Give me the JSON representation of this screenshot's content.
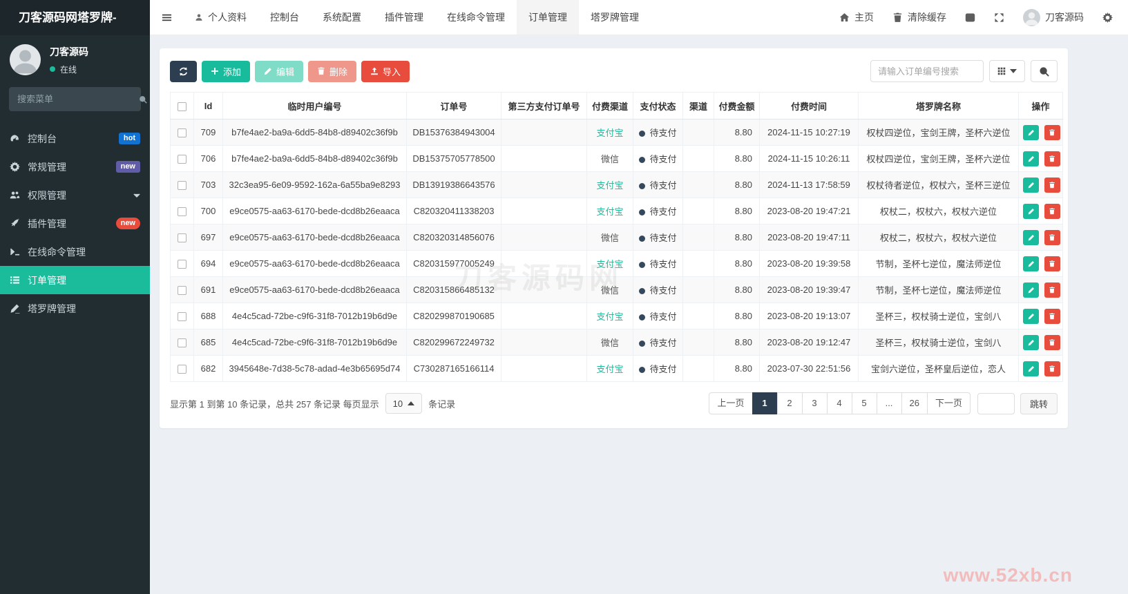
{
  "sidebar": {
    "brand": "刀客源码网塔罗牌-",
    "user": {
      "name": "刀客源码",
      "status": "在线"
    },
    "search_placeholder": "搜索菜单",
    "items": [
      {
        "label": "控制台",
        "badge": "hot"
      },
      {
        "label": "常规管理",
        "badge": "new"
      },
      {
        "label": "权限管理"
      },
      {
        "label": "插件管理",
        "badge": "new"
      },
      {
        "label": "在线命令管理"
      },
      {
        "label": "订单管理"
      },
      {
        "label": "塔罗牌管理"
      }
    ]
  },
  "topbar": {
    "nav": [
      "个人资料",
      "控制台",
      "系统配置",
      "插件管理",
      "在线命令管理",
      "订单管理",
      "塔罗牌管理"
    ],
    "active": "订单管理",
    "home": "主页",
    "clear_cache": "清除缓存",
    "username": "刀客源码"
  },
  "toolbar": {
    "add": "添加",
    "edit": "编辑",
    "delete": "删除",
    "import": "导入",
    "search_placeholder": "请输入订单编号搜索"
  },
  "table": {
    "columns": [
      "Id",
      "临时用户编号",
      "订单号",
      "第三方支付订单号",
      "付费渠道",
      "支付状态",
      "渠道",
      "付费金额",
      "付费时间",
      "塔罗牌名称",
      "操作"
    ],
    "channel_colors": {
      "支付宝": "#1abc9c",
      "微信": "#555555"
    },
    "rows": [
      {
        "id": "709",
        "user_id": "b7fe4ae2-ba9a-6dd5-84b8-d89402c36f9b",
        "order_no": "DB15376384943004",
        "third_party_order_no": "",
        "channel": "支付宝",
        "status": "待支付",
        "qudao": "",
        "amount": "8.80",
        "time": "2024-11-15 10:27:19",
        "tarot": "权杖四逆位，宝剑王牌，圣杯六逆位"
      },
      {
        "id": "706",
        "user_id": "b7fe4ae2-ba9a-6dd5-84b8-d89402c36f9b",
        "order_no": "DB15375705778500",
        "third_party_order_no": "",
        "channel": "微信",
        "status": "待支付",
        "qudao": "",
        "amount": "8.80",
        "time": "2024-11-15 10:26:11",
        "tarot": "权杖四逆位，宝剑王牌，圣杯六逆位"
      },
      {
        "id": "703",
        "user_id": "32c3ea95-6e09-9592-162a-6a55ba9e8293",
        "order_no": "DB13919386643576",
        "third_party_order_no": "",
        "channel": "支付宝",
        "status": "待支付",
        "qudao": "",
        "amount": "8.80",
        "time": "2024-11-13 17:58:59",
        "tarot": "权杖待者逆位，权杖六，圣杯三逆位"
      },
      {
        "id": "700",
        "user_id": "e9ce0575-aa63-6170-bede-dcd8b26eaaca",
        "order_no": "C820320411338203",
        "third_party_order_no": "",
        "channel": "支付宝",
        "status": "待支付",
        "qudao": "",
        "amount": "8.80",
        "time": "2023-08-20 19:47:21",
        "tarot": "权杖二，权杖六，权杖六逆位"
      },
      {
        "id": "697",
        "user_id": "e9ce0575-aa63-6170-bede-dcd8b26eaaca",
        "order_no": "C820320314856076",
        "third_party_order_no": "",
        "channel": "微信",
        "status": "待支付",
        "qudao": "",
        "amount": "8.80",
        "time": "2023-08-20 19:47:11",
        "tarot": "权杖二，权杖六，权杖六逆位"
      },
      {
        "id": "694",
        "user_id": "e9ce0575-aa63-6170-bede-dcd8b26eaaca",
        "order_no": "C820315977005249",
        "third_party_order_no": "",
        "channel": "支付宝",
        "status": "待支付",
        "qudao": "",
        "amount": "8.80",
        "time": "2023-08-20 19:39:58",
        "tarot": "节制，圣杯七逆位，魔法师逆位"
      },
      {
        "id": "691",
        "user_id": "e9ce0575-aa63-6170-bede-dcd8b26eaaca",
        "order_no": "C820315866485132",
        "third_party_order_no": "",
        "channel": "微信",
        "status": "待支付",
        "qudao": "",
        "amount": "8.80",
        "time": "2023-08-20 19:39:47",
        "tarot": "节制，圣杯七逆位，魔法师逆位"
      },
      {
        "id": "688",
        "user_id": "4e4c5cad-72be-c9f6-31f8-7012b19b6d9e",
        "order_no": "C820299870190685",
        "third_party_order_no": "",
        "channel": "支付宝",
        "status": "待支付",
        "qudao": "",
        "amount": "8.80",
        "time": "2023-08-20 19:13:07",
        "tarot": "圣杯三，权杖骑士逆位，宝剑八"
      },
      {
        "id": "685",
        "user_id": "4e4c5cad-72be-c9f6-31f8-7012b19b6d9e",
        "order_no": "C820299672249732",
        "third_party_order_no": "",
        "channel": "微信",
        "status": "待支付",
        "qudao": "",
        "amount": "8.80",
        "time": "2023-08-20 19:12:47",
        "tarot": "圣杯三，权杖骑士逆位，宝剑八"
      },
      {
        "id": "682",
        "user_id": "3945648e-7d38-5c78-adad-4e3b65695d74",
        "order_no": "C730287165166114",
        "third_party_order_no": "",
        "channel": "支付宝",
        "status": "待支付",
        "qudao": "",
        "amount": "8.80",
        "time": "2023-07-30 22:51:56",
        "tarot": "宝剑六逆位，圣杯皇后逆位，恋人"
      }
    ]
  },
  "pagination": {
    "summary": "显示第 1 到第 10 条记录，总共 257 条记录 每页显示",
    "page_size": "10",
    "per_suffix": "条记录",
    "prev": "上一页",
    "pages": [
      "1",
      "2",
      "3",
      "4",
      "5",
      "...",
      "26"
    ],
    "active_page": "1",
    "next": "下一页",
    "jump_label": "跳转"
  },
  "watermarks": {
    "table": "刀客源码网",
    "corner": "www.52xb.cn"
  },
  "colors": {
    "accent": "#1abc9c",
    "danger": "#e74c3c",
    "dark": "#2c3e50",
    "badge_hot": "#1272d2",
    "badge_new_purple": "#605ca8",
    "badge_new_red": "#e74c3c",
    "status_dot": "#34495e"
  }
}
